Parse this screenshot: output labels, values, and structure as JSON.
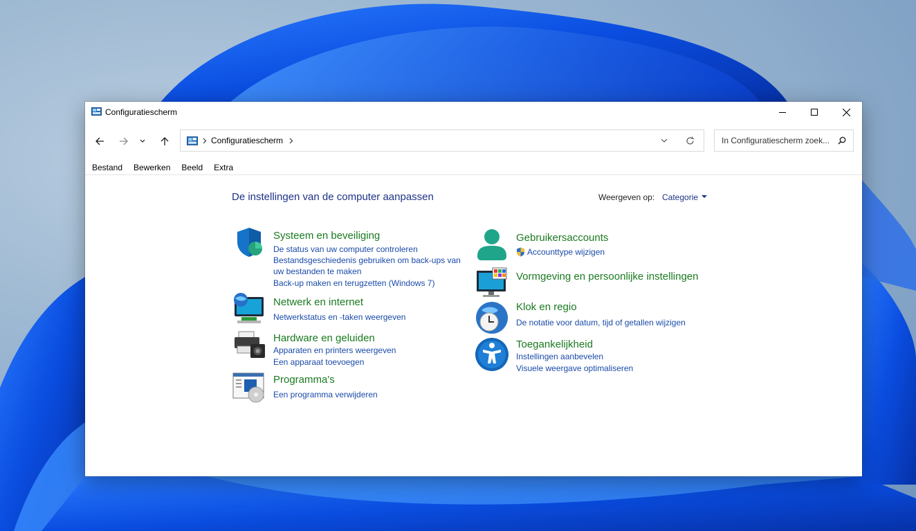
{
  "window": {
    "title": "Configuratiescherm"
  },
  "address": {
    "crumb": "Configuratiescherm"
  },
  "search": {
    "placeholder": "In Configuratiescherm zoek..."
  },
  "menu": [
    "Bestand",
    "Bewerken",
    "Beeld",
    "Extra"
  ],
  "main": {
    "heading": "De instellingen van de computer aanpassen",
    "view_by_label": "Weergeven op:",
    "view_by_value": "Categorie"
  },
  "categories_left": [
    {
      "title": "Systeem en beveiliging",
      "links": [
        "De status van uw computer controleren",
        "Bestandsgeschiedenis gebruiken om back-ups van",
        "uw bestanden te maken",
        "Back-up maken en terugzetten (Windows 7)"
      ]
    },
    {
      "title": "Netwerk en internet",
      "links": [
        "Netwerkstatus en -taken weergeven"
      ]
    },
    {
      "title": "Hardware en geluiden",
      "links": [
        "Apparaten en printers weergeven",
        "Een apparaat toevoegen"
      ]
    },
    {
      "title": "Programma's",
      "links": [
        "Een programma verwijderen"
      ]
    }
  ],
  "categories_right": [
    {
      "title": "Gebruikersaccounts",
      "links": [
        "Accounttype wijzigen"
      ]
    },
    {
      "title": "Vormgeving en persoonlijke instellingen",
      "links": []
    },
    {
      "title": "Klok en regio",
      "links": [
        "De notatie voor datum, tijd of getallen wijzigen"
      ]
    },
    {
      "title": "Toegankelijkheid",
      "links": [
        "Instellingen aanbevelen",
        "Visuele weergave optimaliseren"
      ]
    }
  ],
  "colors": {
    "category_title": "#1a7a20",
    "link": "#1a4aa8",
    "heading": "#1e3287"
  }
}
